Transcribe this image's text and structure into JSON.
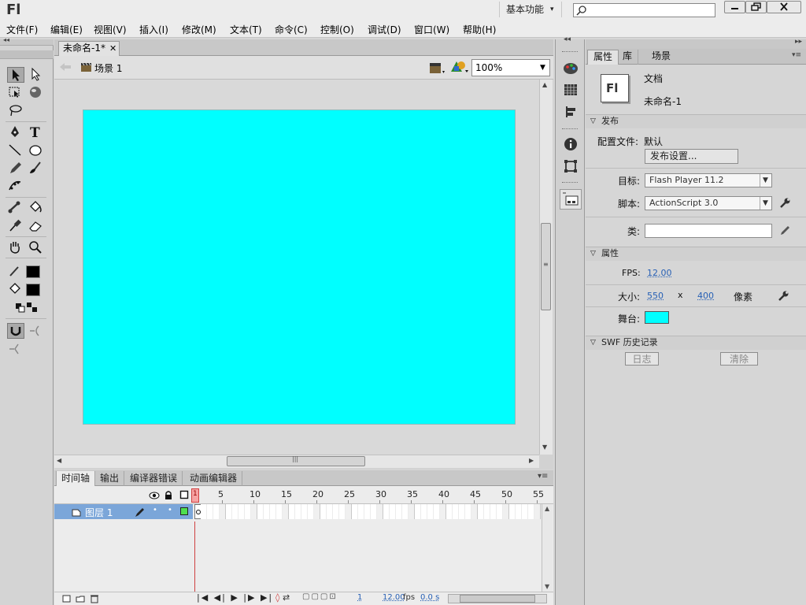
{
  "app": {
    "logo": "Fl",
    "workspace": "基本功能"
  },
  "menu": [
    "文件(F)",
    "编辑(E)",
    "视图(V)",
    "插入(I)",
    "修改(M)",
    "文本(T)",
    "命令(C)",
    "控制(O)",
    "调试(D)",
    "窗口(W)",
    "帮助(H)"
  ],
  "document": {
    "tab_title": "未命名-1*",
    "scene": "场景 1",
    "zoom": "100%"
  },
  "colors": {
    "stage": "#00ffff",
    "fill": "#000000",
    "stroke": "#000000",
    "layer_highlight": "#7ba6d9"
  },
  "timeline": {
    "tabs": [
      "时间轴",
      "输出",
      "编译器错误",
      "动画编辑器"
    ],
    "frame_numbers": [
      "1",
      "5",
      "10",
      "15",
      "20",
      "25",
      "30",
      "35",
      "40",
      "45",
      "50",
      "55"
    ],
    "layer_name": "图层 1",
    "current_frame": "1",
    "fps": "12.00",
    "fps_unit": "fps",
    "time": "0.0 s"
  },
  "properties": {
    "tabs": [
      "属性",
      "库",
      "场景"
    ],
    "doc_type": "文档",
    "doc_name": "未命名-1",
    "doc_icon_text": "Fl",
    "publish": {
      "header": "发布",
      "profile_label": "配置文件:",
      "profile_value": "默认",
      "settings_button": "发布设置...",
      "target_label": "目标:",
      "target_value": "Flash Player 11.2",
      "script_label": "脚本:",
      "script_value": "ActionScript 3.0",
      "class_label": "类:",
      "class_value": ""
    },
    "props": {
      "header": "属性",
      "fps_label": "FPS:",
      "fps_value": "12.00",
      "size_label": "大小:",
      "width": "550",
      "x_sep": "x",
      "height": "400",
      "unit": "像素",
      "stage_label": "舞台:"
    },
    "swf": {
      "header": "SWF 历史记录",
      "log_button": "日志",
      "clear_button": "清除"
    }
  }
}
